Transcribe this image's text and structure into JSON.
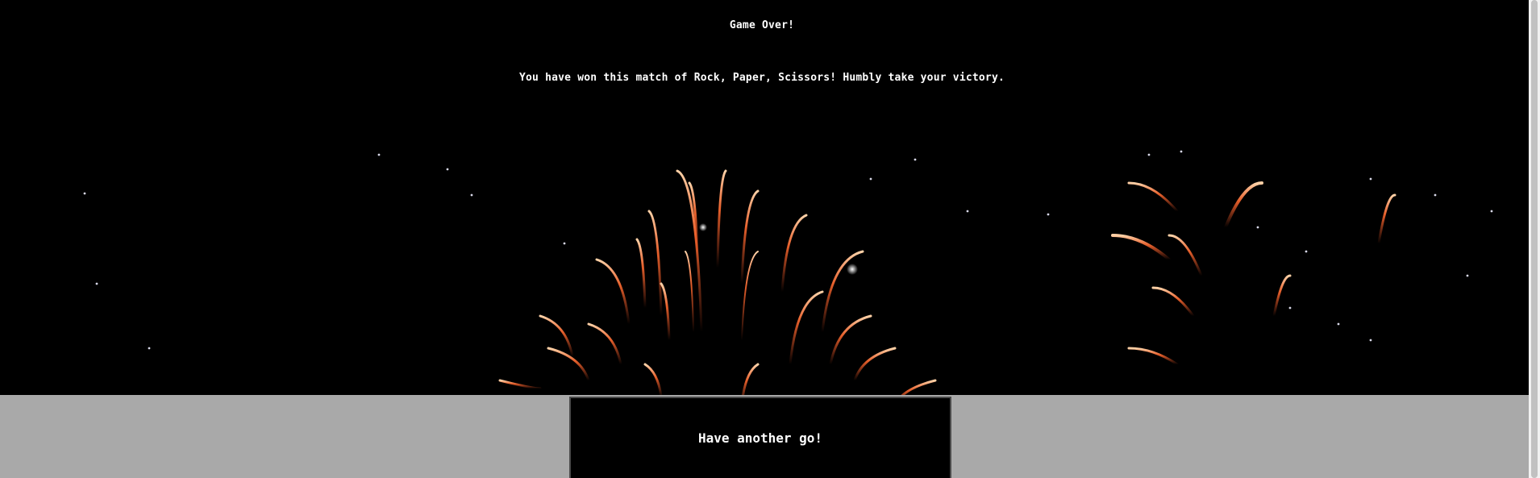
{
  "header": {
    "title": "Game Over!",
    "message": "You have won this match of Rock, Paper, Scissors! Humbly take your victory."
  },
  "background": {
    "icon": "fireworks-image",
    "spark_color": "#ff5a28",
    "glow_color": "#ffd2a8"
  },
  "footer": {
    "play_again_label": "Have another go!"
  },
  "colors": {
    "page_bg": "#000000",
    "footer_bg": "#a9a9a9",
    "text": "#ffffff"
  }
}
